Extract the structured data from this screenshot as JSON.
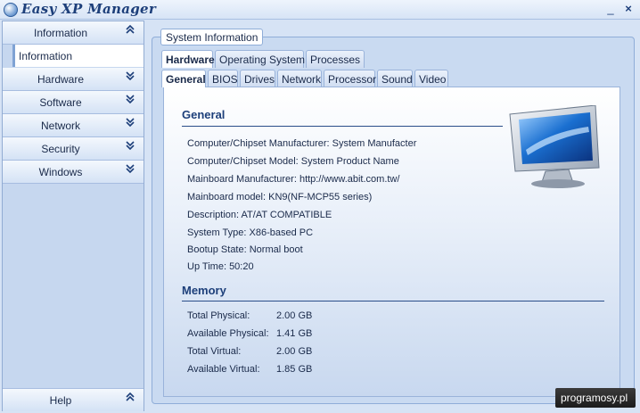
{
  "window": {
    "title": "Easy XP Manager",
    "minimize": "_",
    "close": "×"
  },
  "sidebar": {
    "groups": [
      {
        "label": "Information",
        "chevron": "⌃⌃",
        "expanded": true
      },
      {
        "label": "Hardware",
        "chevron": "⌄⌄"
      },
      {
        "label": "Software",
        "chevron": "⌄⌄"
      },
      {
        "label": "Network",
        "chevron": "⌄⌄"
      },
      {
        "label": "Security",
        "chevron": "⌄⌄"
      },
      {
        "label": "Windows",
        "chevron": "⌄⌄"
      }
    ],
    "selected_item": "Information",
    "footer": {
      "label": "Help",
      "chevron": "⌃⌃"
    }
  },
  "main": {
    "groupbox_title": "System Information",
    "primary_tabs": [
      "Hardware",
      "Operating System",
      "Processes"
    ],
    "secondary_tabs": [
      "General",
      "BIOS",
      "Drives",
      "Network",
      "Processor",
      "Sound",
      "Video"
    ],
    "general": {
      "title": "General",
      "lines": [
        "Computer/Chipset Manufacturer: System Manufacter",
        "Computer/Chipset Model: System Product Name",
        "Mainboard Manufacturer: http://www.abit.com.tw/",
        "Mainboard model: KN9(NF-MCP55 series)",
        "Description: AT/AT COMPATIBLE",
        "System Type: X86-based PC",
        "Bootup State: Normal boot",
        "Up Time: 50:20"
      ]
    },
    "memory": {
      "title": "Memory",
      "rows": [
        {
          "label": "Total Physical:",
          "value": "2.00 GB"
        },
        {
          "label": "Available Physical:",
          "value": "1.41 GB"
        },
        {
          "label": "Total Virtual:",
          "value": "2.00 GB"
        },
        {
          "label": "Available Virtual:",
          "value": "1.85 GB"
        }
      ]
    }
  },
  "watermark": "programosy.pl"
}
